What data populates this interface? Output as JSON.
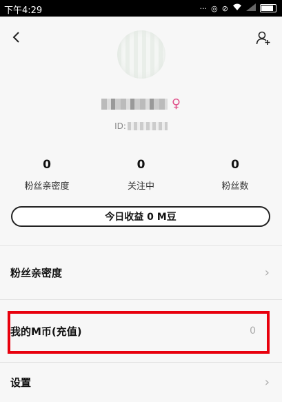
{
  "status_bar": {
    "time": "下午4:29",
    "icons": [
      "more-icon",
      "alarm-icon",
      "mute-icon",
      "wifi-icon",
      "signal-icon",
      "battery-icon"
    ]
  },
  "profile": {
    "gender_symbol": "♀",
    "id_prefix": "ID:"
  },
  "stats": [
    {
      "value": "0",
      "label": "粉丝亲密度"
    },
    {
      "value": "0",
      "label": "关注中"
    },
    {
      "value": "0",
      "label": "粉丝数"
    }
  ],
  "earnings_button": "今日收益 0 M豆",
  "menu": {
    "fan_intimacy": "粉丝亲密度",
    "my_coins": "我的M币(充值)",
    "my_coins_value": "0",
    "settings": "设置"
  },
  "colors": {
    "highlight": "#e8000d",
    "gender": "#e0508a"
  }
}
